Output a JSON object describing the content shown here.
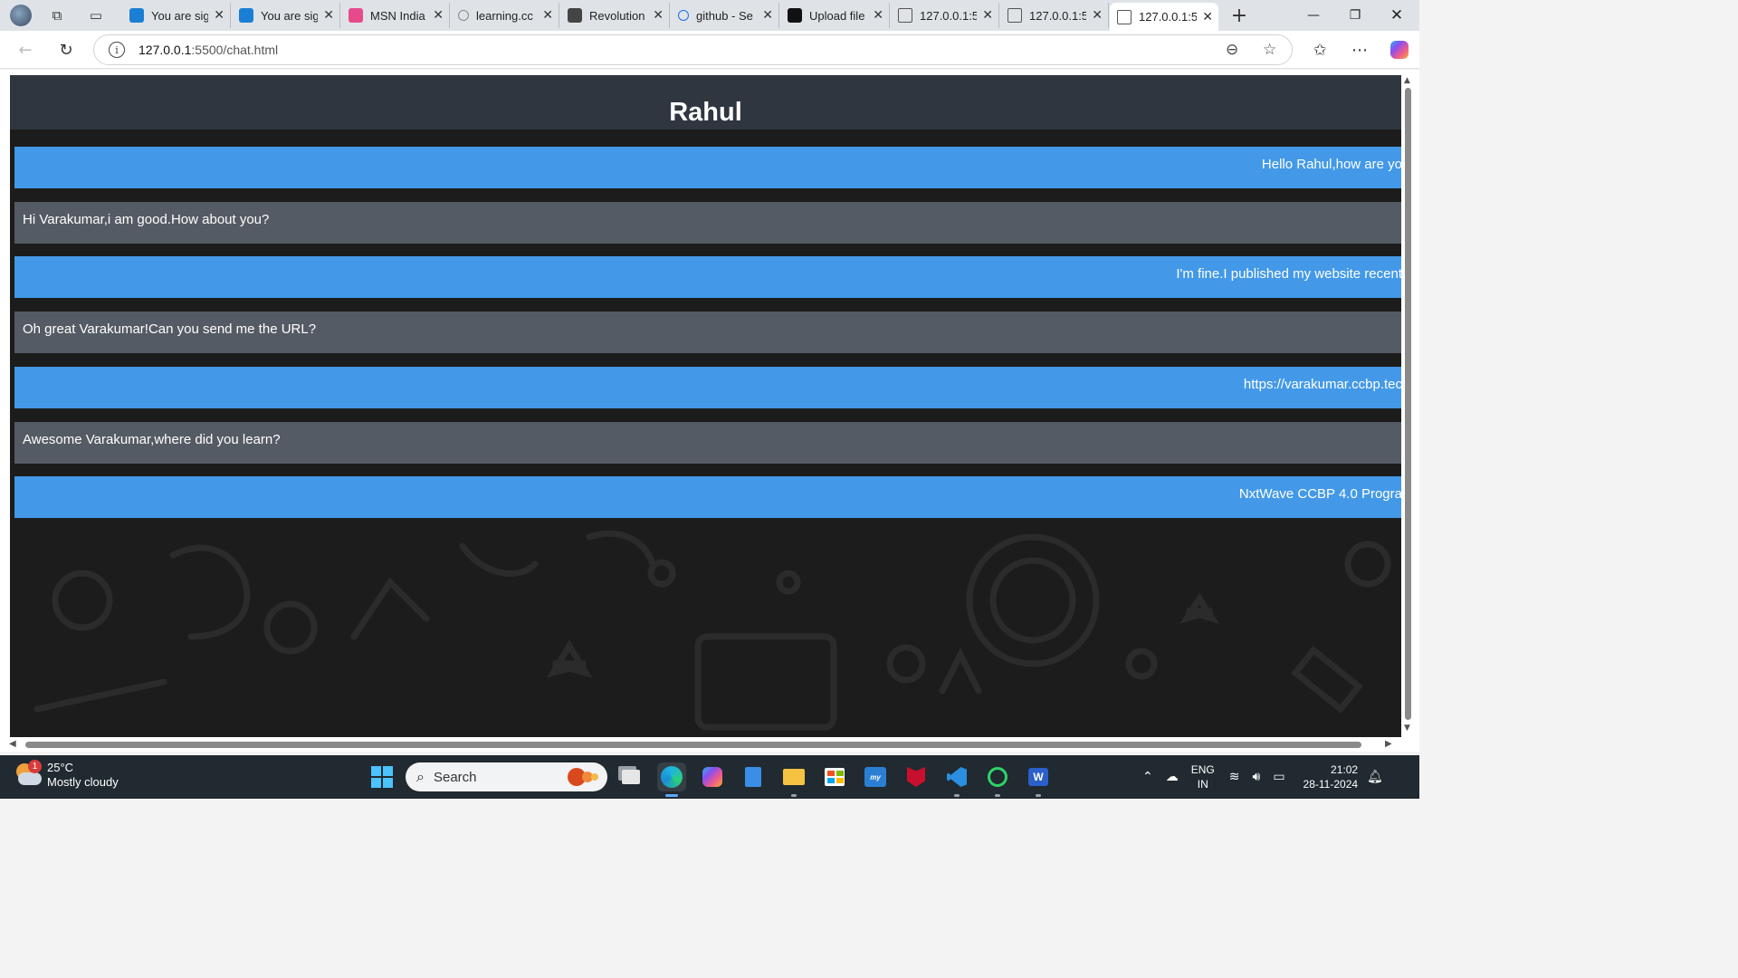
{
  "browser": {
    "tabs": [
      {
        "title": "You are sig",
        "favicon": "s-logo-icon",
        "color": "#1a7fd4"
      },
      {
        "title": "You are sig",
        "favicon": "s-logo-icon",
        "color": "#1a7fd4"
      },
      {
        "title": "MSN India",
        "favicon": "msn-butterfly-icon",
        "color": "#e64a8b"
      },
      {
        "title": "learning.cc",
        "favicon": "search-icon",
        "color": "#888888"
      },
      {
        "title": "Revolution",
        "favicon": "nxtwave-icon",
        "color": "#444444"
      },
      {
        "title": "github - Se",
        "favicon": "search-icon",
        "color": "#1a73e8"
      },
      {
        "title": "Upload file",
        "favicon": "github-icon",
        "color": "#111111"
      },
      {
        "title": "127.0.0.1:5",
        "favicon": "page-icon",
        "color": "#555555"
      },
      {
        "title": "127.0.0.1:5",
        "favicon": "page-icon",
        "color": "#555555"
      },
      {
        "title": "127.0.0.1:5",
        "favicon": "page-icon",
        "color": "#555555",
        "active": true
      }
    ],
    "url_host": "127.0.0.1",
    "url_rest": ":5500/chat.html"
  },
  "chat": {
    "header_name": "Rahul",
    "messages": [
      {
        "text": "Hello Rahul,how are yo",
        "type": "sent"
      },
      {
        "text": "Hi Varakumar,i am good.How about you?",
        "type": "recv"
      },
      {
        "text": "I'm fine.I published my website recent",
        "type": "sent"
      },
      {
        "text": "Oh great Varakumar!Can you send me the URL?",
        "type": "recv"
      },
      {
        "text": "https://varakumar.ccbp.tec",
        "type": "sent"
      },
      {
        "text": "Awesome Varakumar,where did you learn?",
        "type": "recv"
      },
      {
        "text": "NxtWave CCBP 4.0 Progra",
        "type": "sent"
      }
    ],
    "colors": {
      "sent": "#4399e8",
      "recv": "#555b64",
      "header": "#2f3640",
      "background": "#1c1c1c"
    }
  },
  "taskbar": {
    "weather_temp": "25°C",
    "weather_desc": "Mostly cloudy",
    "weather_badge": "1",
    "search_placeholder": "Search",
    "lang_line1": "ENG",
    "lang_line2": "IN",
    "time": "21:02",
    "date": "28-11-2024"
  }
}
